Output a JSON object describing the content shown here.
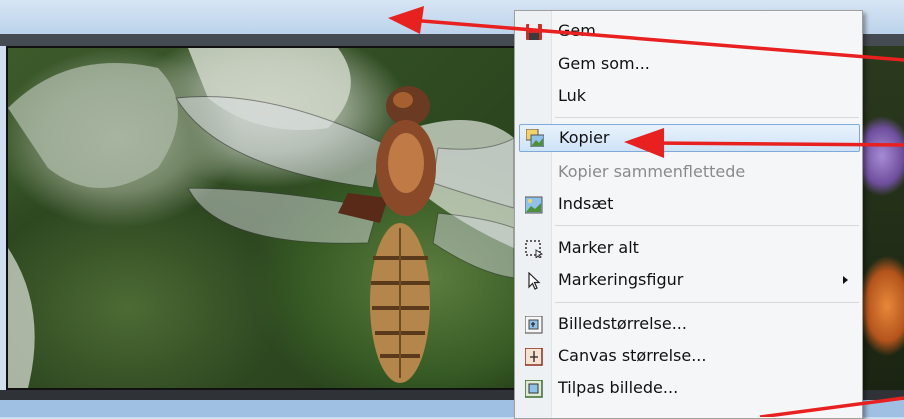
{
  "menu": {
    "items": [
      {
        "label": "Gem",
        "icon": "floppy-disk-icon"
      },
      {
        "label": "Gem som...",
        "icon": ""
      },
      {
        "label": "Luk",
        "icon": ""
      },
      {
        "label": "Kopier",
        "icon": "copy-image-icon",
        "highlighted": true
      },
      {
        "label": "Kopier sammenflettede",
        "icon": "",
        "disabled": true
      },
      {
        "label": "Indsæt",
        "icon": "paste-image-icon"
      },
      {
        "label": "Marker alt",
        "icon": "select-all-icon"
      },
      {
        "label": "Markeringsfigur",
        "icon": "cursor-arrow-icon",
        "submenu": true
      },
      {
        "label": "Billedstørrelse...",
        "icon": "image-size-icon"
      },
      {
        "label": "Canvas størrelse...",
        "icon": "canvas-size-icon"
      },
      {
        "label": "Tilpas billede...",
        "icon": "fit-image-icon"
      }
    ]
  },
  "colors": {
    "arrow": "#e8201f",
    "highlight_border": "#7ea9d8",
    "menu_background": "#f5f6f7"
  }
}
